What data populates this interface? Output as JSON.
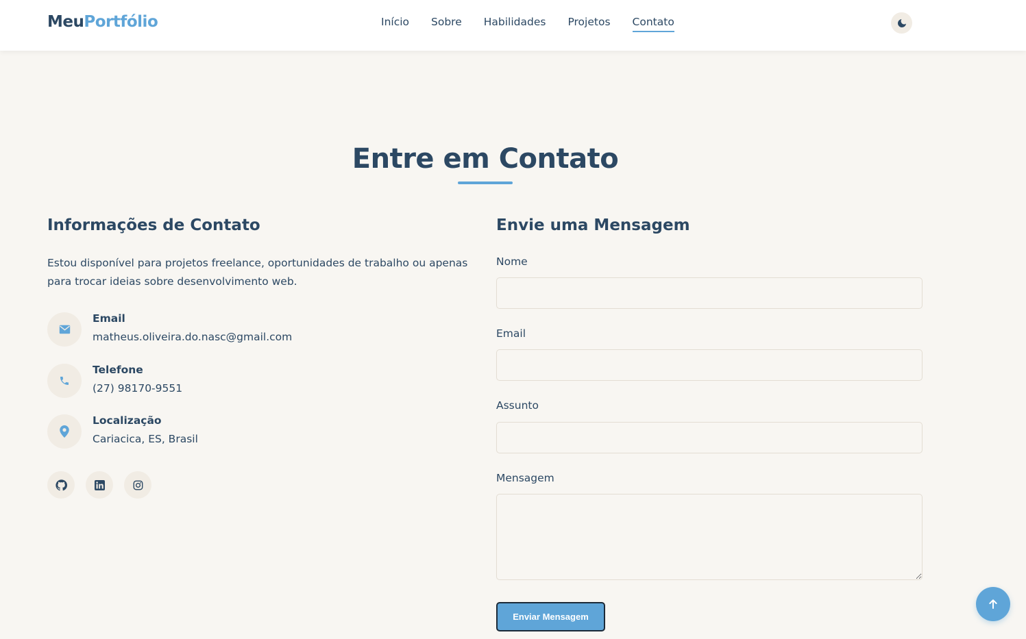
{
  "brand": {
    "logo_part1": "Meu",
    "logo_part2": "Portfólio"
  },
  "nav": {
    "links": [
      {
        "label": "Início",
        "active": false
      },
      {
        "label": "Sobre",
        "active": false
      },
      {
        "label": "Habilidades",
        "active": false
      },
      {
        "label": "Projetos",
        "active": false
      },
      {
        "label": "Contato",
        "active": true
      }
    ],
    "theme_icon": "moon-icon"
  },
  "section": {
    "title": "Entre em Contato"
  },
  "contact_info": {
    "title": "Informações de Contato",
    "intro": "Estou disponível para projetos freelance, oportunidades de trabalho ou apenas para trocar ideias sobre desenvolvimento web.",
    "items": [
      {
        "icon": "envelope-icon",
        "label": "Email",
        "value": "matheus.oliveira.do.nasc@gmail.com"
      },
      {
        "icon": "phone-icon",
        "label": "Telefone",
        "value": "(27) 98170-9551"
      },
      {
        "icon": "map-pin-icon",
        "label": "Localização",
        "value": "Cariacica, ES, Brasil"
      }
    ],
    "social": [
      {
        "icon": "github-icon"
      },
      {
        "icon": "linkedin-icon"
      },
      {
        "icon": "instagram-icon"
      }
    ]
  },
  "form": {
    "title": "Envie uma Mensagem",
    "fields": {
      "name": {
        "label": "Nome",
        "value": ""
      },
      "email": {
        "label": "Email",
        "value": ""
      },
      "subject": {
        "label": "Assunto",
        "value": ""
      },
      "message": {
        "label": "Mensagem",
        "value": ""
      }
    },
    "submit_label": "Enviar Mensagem"
  },
  "back_to_top_icon": "arrow-up-icon",
  "colors": {
    "primary": "#2c4863",
    "accent": "#5fa5d8",
    "background": "#f8f6f2",
    "icon_bg": "#f1ece4"
  }
}
